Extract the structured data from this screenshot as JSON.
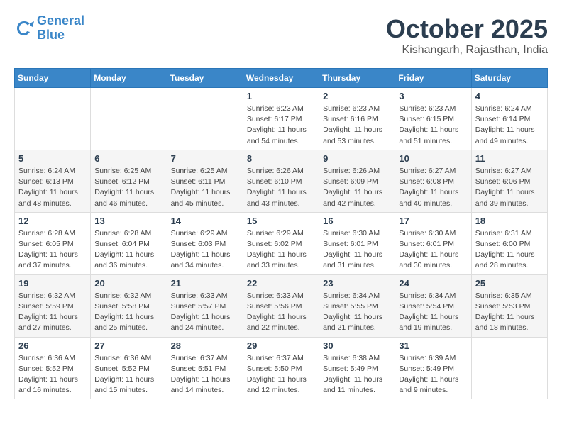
{
  "header": {
    "logo_line1": "General",
    "logo_line2": "Blue",
    "month": "October 2025",
    "location": "Kishangarh, Rajasthan, India"
  },
  "weekdays": [
    "Sunday",
    "Monday",
    "Tuesday",
    "Wednesday",
    "Thursday",
    "Friday",
    "Saturday"
  ],
  "weeks": [
    [
      {
        "day": "",
        "info": ""
      },
      {
        "day": "",
        "info": ""
      },
      {
        "day": "",
        "info": ""
      },
      {
        "day": "1",
        "info": "Sunrise: 6:23 AM\nSunset: 6:17 PM\nDaylight: 11 hours\nand 54 minutes."
      },
      {
        "day": "2",
        "info": "Sunrise: 6:23 AM\nSunset: 6:16 PM\nDaylight: 11 hours\nand 53 minutes."
      },
      {
        "day": "3",
        "info": "Sunrise: 6:23 AM\nSunset: 6:15 PM\nDaylight: 11 hours\nand 51 minutes."
      },
      {
        "day": "4",
        "info": "Sunrise: 6:24 AM\nSunset: 6:14 PM\nDaylight: 11 hours\nand 49 minutes."
      }
    ],
    [
      {
        "day": "5",
        "info": "Sunrise: 6:24 AM\nSunset: 6:13 PM\nDaylight: 11 hours\nand 48 minutes."
      },
      {
        "day": "6",
        "info": "Sunrise: 6:25 AM\nSunset: 6:12 PM\nDaylight: 11 hours\nand 46 minutes."
      },
      {
        "day": "7",
        "info": "Sunrise: 6:25 AM\nSunset: 6:11 PM\nDaylight: 11 hours\nand 45 minutes."
      },
      {
        "day": "8",
        "info": "Sunrise: 6:26 AM\nSunset: 6:10 PM\nDaylight: 11 hours\nand 43 minutes."
      },
      {
        "day": "9",
        "info": "Sunrise: 6:26 AM\nSunset: 6:09 PM\nDaylight: 11 hours\nand 42 minutes."
      },
      {
        "day": "10",
        "info": "Sunrise: 6:27 AM\nSunset: 6:08 PM\nDaylight: 11 hours\nand 40 minutes."
      },
      {
        "day": "11",
        "info": "Sunrise: 6:27 AM\nSunset: 6:06 PM\nDaylight: 11 hours\nand 39 minutes."
      }
    ],
    [
      {
        "day": "12",
        "info": "Sunrise: 6:28 AM\nSunset: 6:05 PM\nDaylight: 11 hours\nand 37 minutes."
      },
      {
        "day": "13",
        "info": "Sunrise: 6:28 AM\nSunset: 6:04 PM\nDaylight: 11 hours\nand 36 minutes."
      },
      {
        "day": "14",
        "info": "Sunrise: 6:29 AM\nSunset: 6:03 PM\nDaylight: 11 hours\nand 34 minutes."
      },
      {
        "day": "15",
        "info": "Sunrise: 6:29 AM\nSunset: 6:02 PM\nDaylight: 11 hours\nand 33 minutes."
      },
      {
        "day": "16",
        "info": "Sunrise: 6:30 AM\nSunset: 6:01 PM\nDaylight: 11 hours\nand 31 minutes."
      },
      {
        "day": "17",
        "info": "Sunrise: 6:30 AM\nSunset: 6:01 PM\nDaylight: 11 hours\nand 30 minutes."
      },
      {
        "day": "18",
        "info": "Sunrise: 6:31 AM\nSunset: 6:00 PM\nDaylight: 11 hours\nand 28 minutes."
      }
    ],
    [
      {
        "day": "19",
        "info": "Sunrise: 6:32 AM\nSunset: 5:59 PM\nDaylight: 11 hours\nand 27 minutes."
      },
      {
        "day": "20",
        "info": "Sunrise: 6:32 AM\nSunset: 5:58 PM\nDaylight: 11 hours\nand 25 minutes."
      },
      {
        "day": "21",
        "info": "Sunrise: 6:33 AM\nSunset: 5:57 PM\nDaylight: 11 hours\nand 24 minutes."
      },
      {
        "day": "22",
        "info": "Sunrise: 6:33 AM\nSunset: 5:56 PM\nDaylight: 11 hours\nand 22 minutes."
      },
      {
        "day": "23",
        "info": "Sunrise: 6:34 AM\nSunset: 5:55 PM\nDaylight: 11 hours\nand 21 minutes."
      },
      {
        "day": "24",
        "info": "Sunrise: 6:34 AM\nSunset: 5:54 PM\nDaylight: 11 hours\nand 19 minutes."
      },
      {
        "day": "25",
        "info": "Sunrise: 6:35 AM\nSunset: 5:53 PM\nDaylight: 11 hours\nand 18 minutes."
      }
    ],
    [
      {
        "day": "26",
        "info": "Sunrise: 6:36 AM\nSunset: 5:52 PM\nDaylight: 11 hours\nand 16 minutes."
      },
      {
        "day": "27",
        "info": "Sunrise: 6:36 AM\nSunset: 5:52 PM\nDaylight: 11 hours\nand 15 minutes."
      },
      {
        "day": "28",
        "info": "Sunrise: 6:37 AM\nSunset: 5:51 PM\nDaylight: 11 hours\nand 14 minutes."
      },
      {
        "day": "29",
        "info": "Sunrise: 6:37 AM\nSunset: 5:50 PM\nDaylight: 11 hours\nand 12 minutes."
      },
      {
        "day": "30",
        "info": "Sunrise: 6:38 AM\nSunset: 5:49 PM\nDaylight: 11 hours\nand 11 minutes."
      },
      {
        "day": "31",
        "info": "Sunrise: 6:39 AM\nSunset: 5:49 PM\nDaylight: 11 hours\nand 9 minutes."
      },
      {
        "day": "",
        "info": ""
      }
    ]
  ]
}
